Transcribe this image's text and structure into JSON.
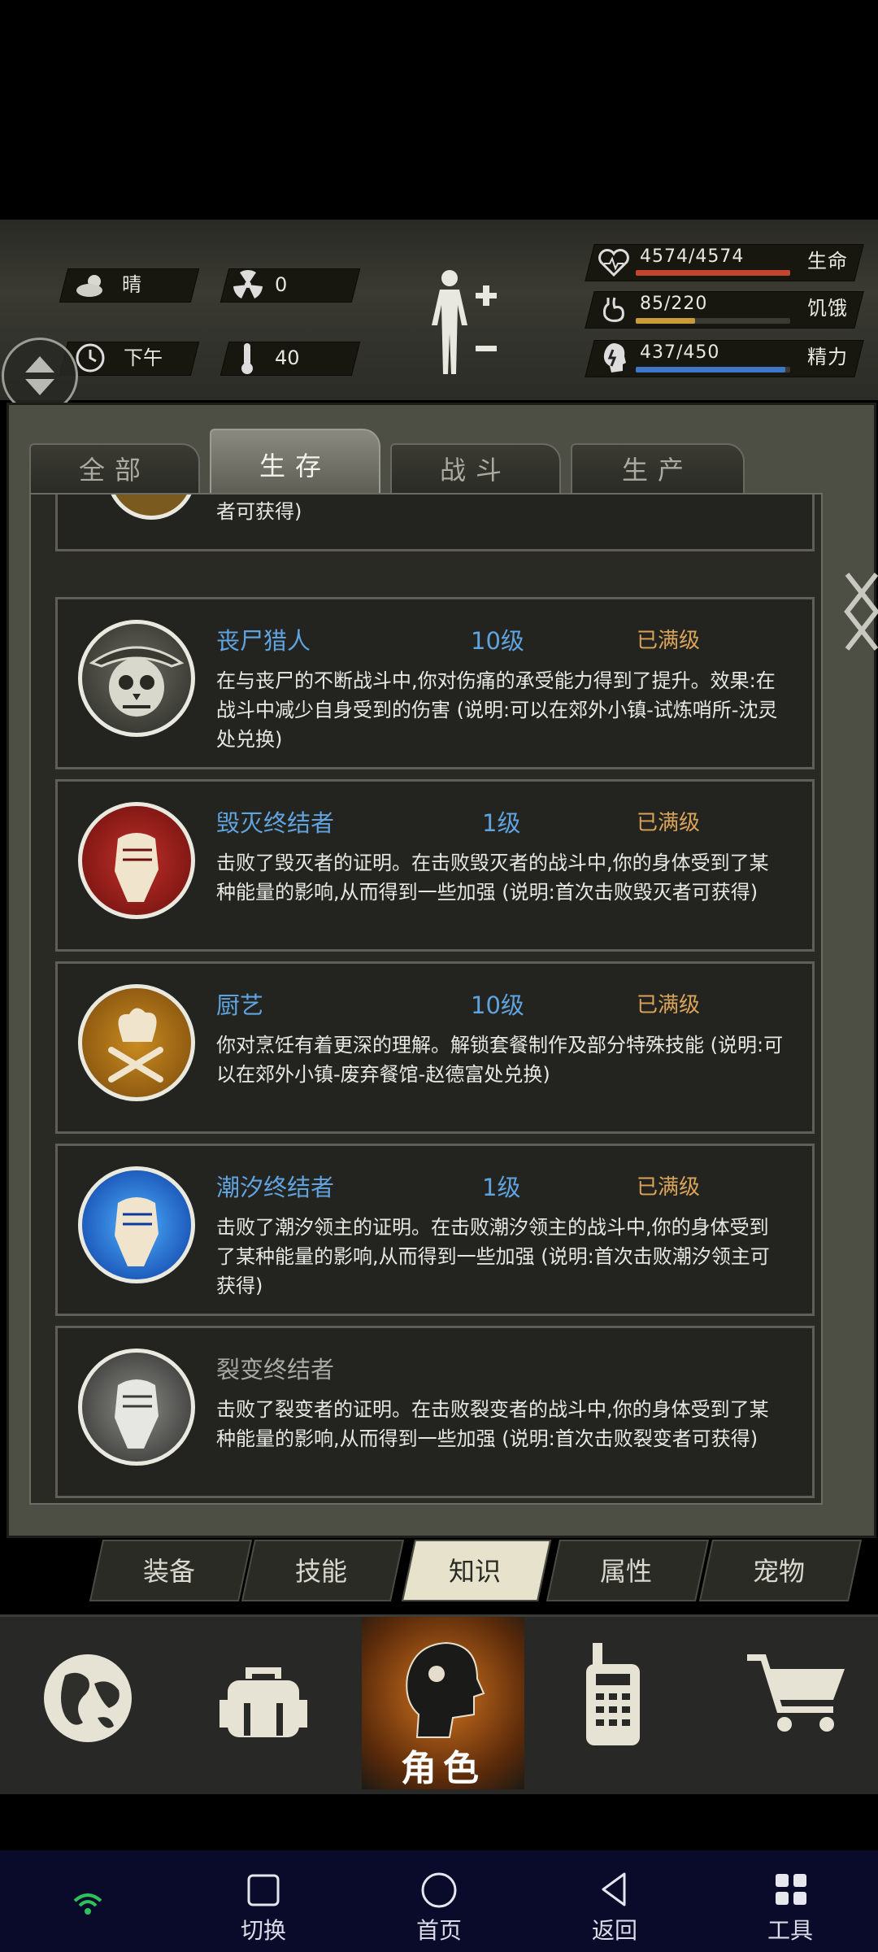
{
  "status": {
    "weather": "晴",
    "radiation": "0",
    "time_of_day": "下午",
    "temperature": "40"
  },
  "vitals": [
    {
      "value": "4574/4574",
      "label": "生命",
      "fill": 1.0,
      "color": "#c4452d"
    },
    {
      "value": "85/220",
      "label": "饥饿",
      "fill": 0.386,
      "color": "#c79a3a"
    },
    {
      "value": "437/450",
      "label": "精力",
      "fill": 0.971,
      "color": "#3f77c7"
    }
  ],
  "tabs": [
    "全部",
    "生存",
    "战斗",
    "生产"
  ],
  "active_tab": "生存",
  "partial_card_text": "者可获得)",
  "cards": [
    {
      "name": "丧尸猎人",
      "level": "10级",
      "status": "已满级",
      "desc": "在与丧尸的不断战斗中,你对伤痛的承受能力得到了提升。效果:在战斗中减少自身受到的伤害 (说明:可以在郊外小镇-试炼哨所-沈灵处兑换)",
      "icon": "zombie-hunter-skull-icon"
    },
    {
      "name": "毁灭终结者",
      "level": "1级",
      "status": "已满级",
      "desc": "击败了毁灭者的证明。在击败毁灭者的战斗中,你的身体受到了某种能量的影响,从而得到一些加强 (说明:首次击败毁灭者可获得)",
      "icon": "red-fist-icon"
    },
    {
      "name": "厨艺",
      "level": "10级",
      "status": "已满级",
      "desc": "你对烹饪有着更深的理解。解锁套餐制作及部分特殊技能 (说明:可以在郊外小镇-废弃餐馆-赵德富处兑换)",
      "icon": "chef-hat-icon"
    },
    {
      "name": "潮汐终结者",
      "level": "1级",
      "status": "已满级",
      "desc": "击败了潮汐领主的证明。在击败潮汐领主的战斗中,你的身体受到了某种能量的影响,从而得到一些加强 (说明:首次击败潮汐领主可获得)",
      "icon": "blue-fist-icon"
    },
    {
      "name": "裂变终结者",
      "level": "",
      "status": "",
      "desc": "击败了裂变者的证明。在击败裂变者的战斗中,你的身体受到了某种能量的影响,从而得到一些加强 (说明:首次击败裂变者可获得)",
      "icon": "gray-fist-icon"
    }
  ],
  "sub_tabs": [
    "装备",
    "技能",
    "知识",
    "属性",
    "宠物"
  ],
  "active_sub_tab": "知识",
  "nav": {
    "active_label": "角色"
  },
  "system_nav": [
    "切换",
    "首页",
    "返回",
    "工具"
  ]
}
